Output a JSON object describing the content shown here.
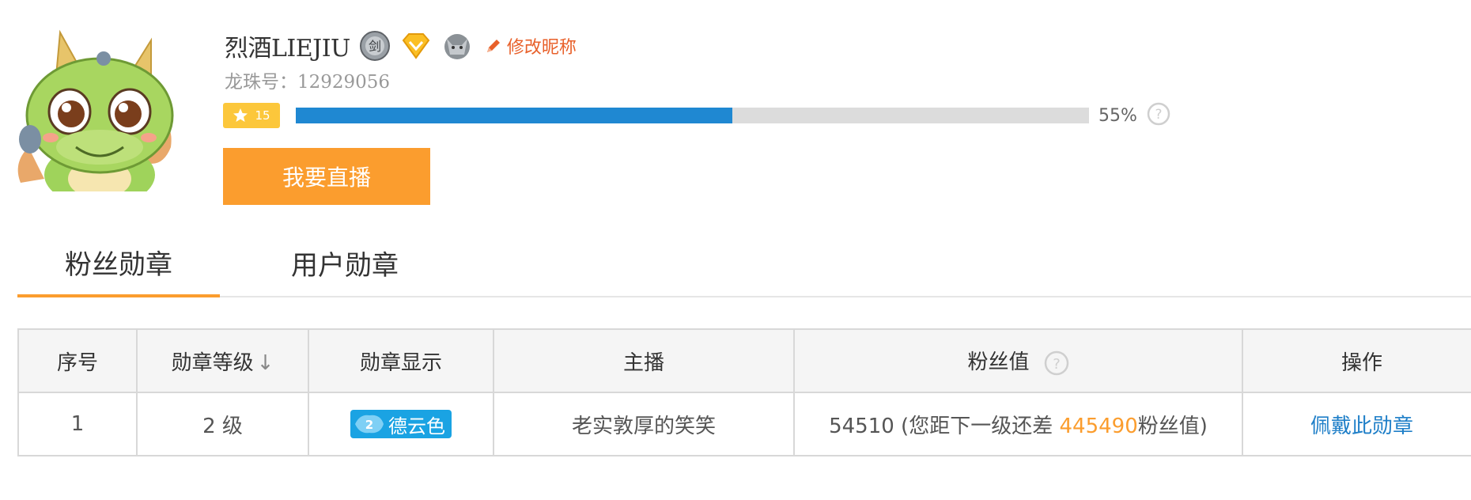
{
  "profile": {
    "username": "烈酒LIEJIU",
    "edit_nickname": "修改昵称",
    "id_label": "龙珠号：",
    "id_value": "12929056",
    "level": "15",
    "progress_percent": 55,
    "progress_text": "55%",
    "live_button": "我要直播",
    "badge_icons": [
      "sword-rank-icon",
      "diamond-vip-icon",
      "wolf-emblem-icon"
    ]
  },
  "tabs": [
    {
      "label": "粉丝勋章",
      "active": true
    },
    {
      "label": "用户勋章",
      "active": false
    }
  ],
  "table": {
    "headers": [
      "序号",
      "勋章等级",
      "勋章显示",
      "主播",
      "粉丝值",
      "操作"
    ],
    "sort_indicator": "↓",
    "rows": [
      {
        "index": "1",
        "level": "2 级",
        "medal_number": "2",
        "medal_name": "德云色",
        "anchor": "老实敦厚的笑笑",
        "fan_value": "54510",
        "fan_prefix": " (您距下一级还差 ",
        "fan_needed": "445490",
        "fan_suffix": "粉丝值)",
        "action": "佩戴此勋章"
      }
    ]
  },
  "colors": {
    "accent": "#fb9d2e",
    "progress": "#1f88d2",
    "link": "#1f7fc8",
    "medal": "#1aa3e3",
    "edit": "#e8602a"
  }
}
